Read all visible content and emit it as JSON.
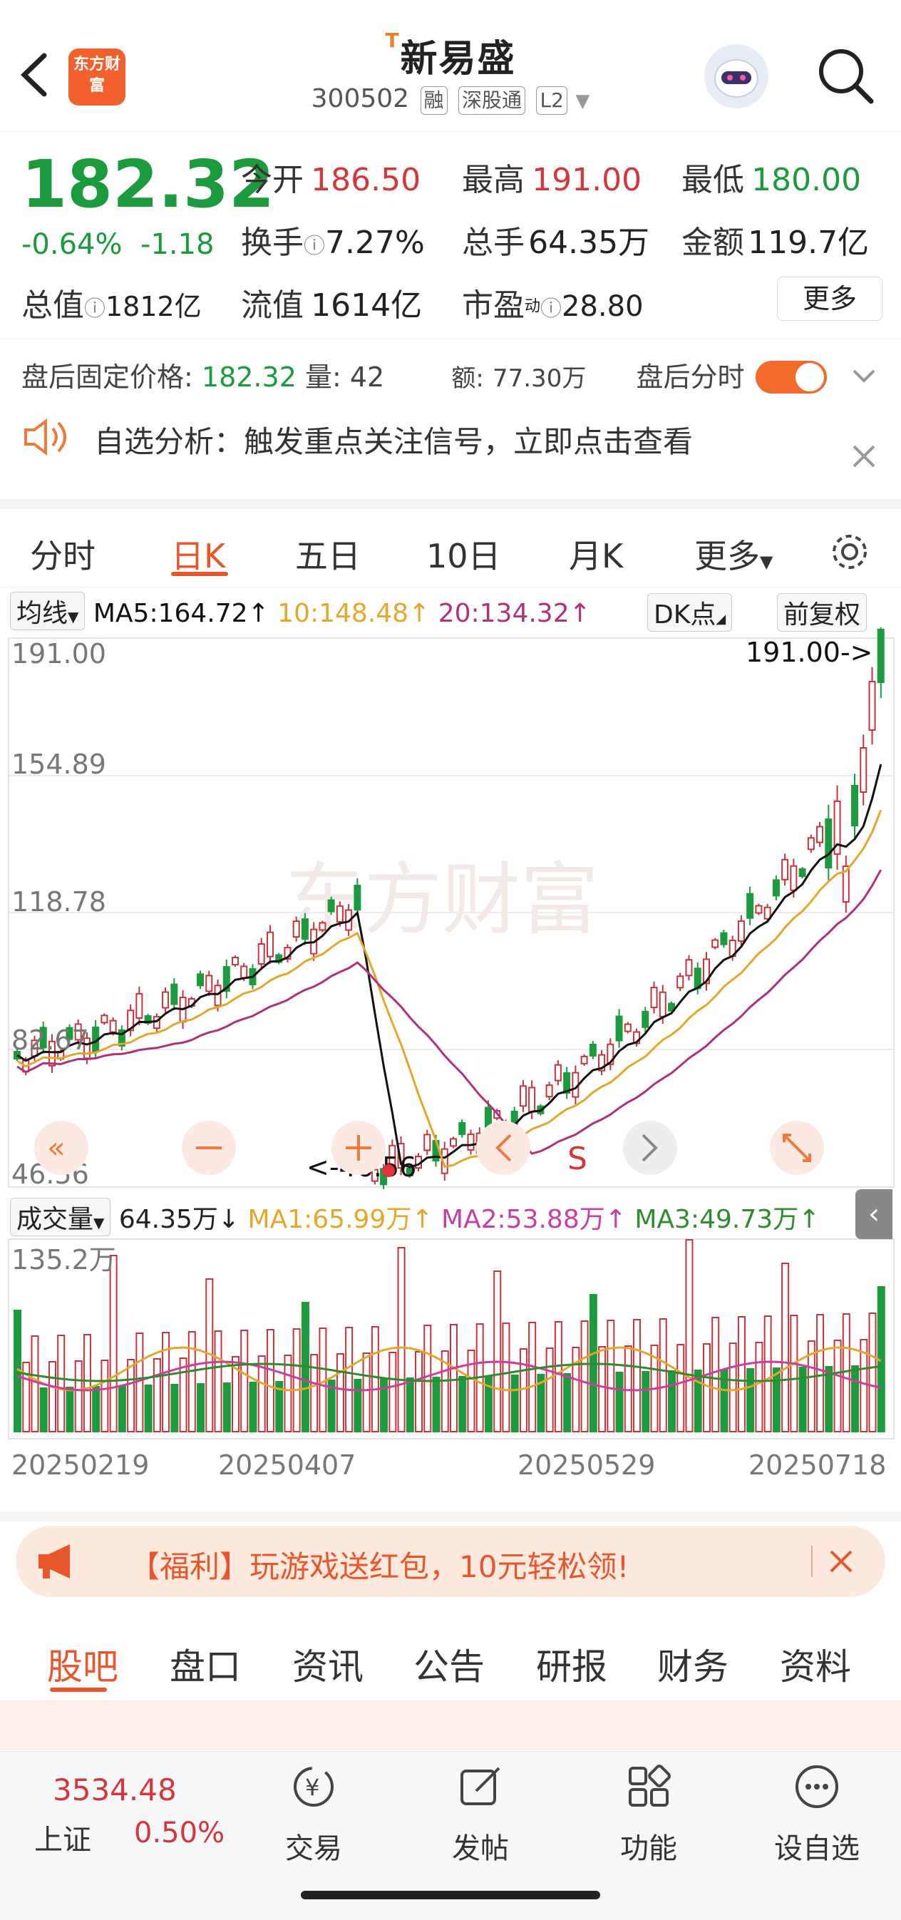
{
  "header": {
    "logo_text": "东方财富",
    "stock_name": "新易盛",
    "stock_mark": "T",
    "code": "300502",
    "tags": [
      "融",
      "深股通",
      "L2"
    ]
  },
  "quote": {
    "price": "182.32",
    "change_pct": "-0.64%",
    "change_amt": "-1.18",
    "open_label": "今开",
    "open": "186.50",
    "high_label": "最高",
    "high": "191.00",
    "low_label": "最低",
    "low": "180.00",
    "turnover_label": "换手",
    "turnover": "7.27%",
    "volume_label": "总手",
    "volume": "64.35万",
    "amount_label": "金额",
    "amount": "119.7亿",
    "mcap_label": "总值",
    "mcap": "1812亿",
    "float_label": "流值",
    "float": "1614亿",
    "pe_label": "市盈",
    "pe_sup": "动",
    "pe": "28.80",
    "more": "更多"
  },
  "after_hours": {
    "price_label": "盘后固定价格:",
    "price": "182.32",
    "qty_label": "量:",
    "qty": "42",
    "amt_label": "额:",
    "amt": "77.30万",
    "toggle_label": "盘后分时"
  },
  "alert": {
    "text": "自选分析：触发重点关注信号，立即点击查看"
  },
  "tabs": [
    "分时",
    "日K",
    "五日",
    "10日",
    "月K",
    "更多"
  ],
  "ma": {
    "label": "均线",
    "ma5": "MA5:164.72↑",
    "ma10": "10:148.48↑",
    "ma20": "20:134.32↑",
    "dk": "DK点",
    "fq": "前复权",
    "colors": {
      "ma5": "#111111",
      "ma10": "#e5a72a",
      "ma20": "#b0317b"
    }
  },
  "kline": {
    "y_labels": [
      "191.00",
      "154.89",
      "118.78",
      "82.67",
      "46.56"
    ],
    "max_marker": "191.00->",
    "min_marker": "<-46.56",
    "watermark": "东方财富",
    "s_mark": "S"
  },
  "volume": {
    "label": "成交量",
    "value": "64.35万↓",
    "ma1": "MA1:65.99万↑",
    "ma2": "MA2:53.88万↑",
    "ma3": "MA3:49.73万↑",
    "max_label": "135.2万",
    "dates": [
      "20250219",
      "20250407",
      "20250529",
      "20250718"
    ],
    "colors": {
      "ma1": "#e5a72a",
      "ma2": "#c83fa0",
      "ma3": "#2e8b2e"
    }
  },
  "banner": {
    "text": "【福利】玩游戏送红包，10元轻松领!"
  },
  "bottom_tabs": [
    "股吧",
    "盘口",
    "资讯",
    "公告",
    "研报",
    "财务",
    "资料"
  ],
  "footer": {
    "index_value": "3534.48",
    "index_name": "上证",
    "index_pct": "0.50%",
    "items": [
      "交易",
      "发帖",
      "功能",
      "设自选"
    ]
  }
}
